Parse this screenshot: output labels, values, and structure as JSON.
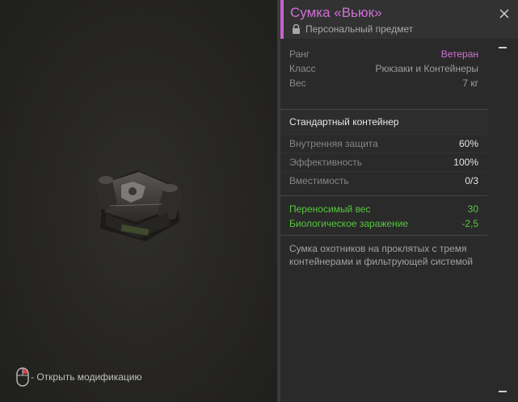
{
  "item": {
    "name": "Сумка «Вьюк»",
    "personal_label": "Персональный предмет",
    "rank_label": "Ранг",
    "rank_value": "Ветеран",
    "class_label": "Класс",
    "class_value": "Рюкзаки и Контейнеры",
    "weight_label": "Вес",
    "weight_value": "7 кг",
    "container_type": "Стандартный контейнер",
    "stats": [
      {
        "label": "Внутренняя защита",
        "value": "60%"
      },
      {
        "label": "Эффективность",
        "value": "100%"
      },
      {
        "label": "Вместимость",
        "value": "0/3"
      }
    ],
    "bonuses": [
      {
        "label": "Переносимый вес",
        "value": "30"
      },
      {
        "label": "Биологическое заражение",
        "value": "-2,5"
      }
    ],
    "description": "Сумка охотников на проклятых с тремя контейнерами и фильтрующей системой"
  },
  "hint": {
    "text": "- Открыть модификацию"
  },
  "icons": {
    "close": "close-icon",
    "lock": "lock-icon",
    "mouse": "mouse-right-click-icon"
  },
  "colors": {
    "rank_accent": "#d070d6",
    "bonus_green": "#55c83d"
  }
}
